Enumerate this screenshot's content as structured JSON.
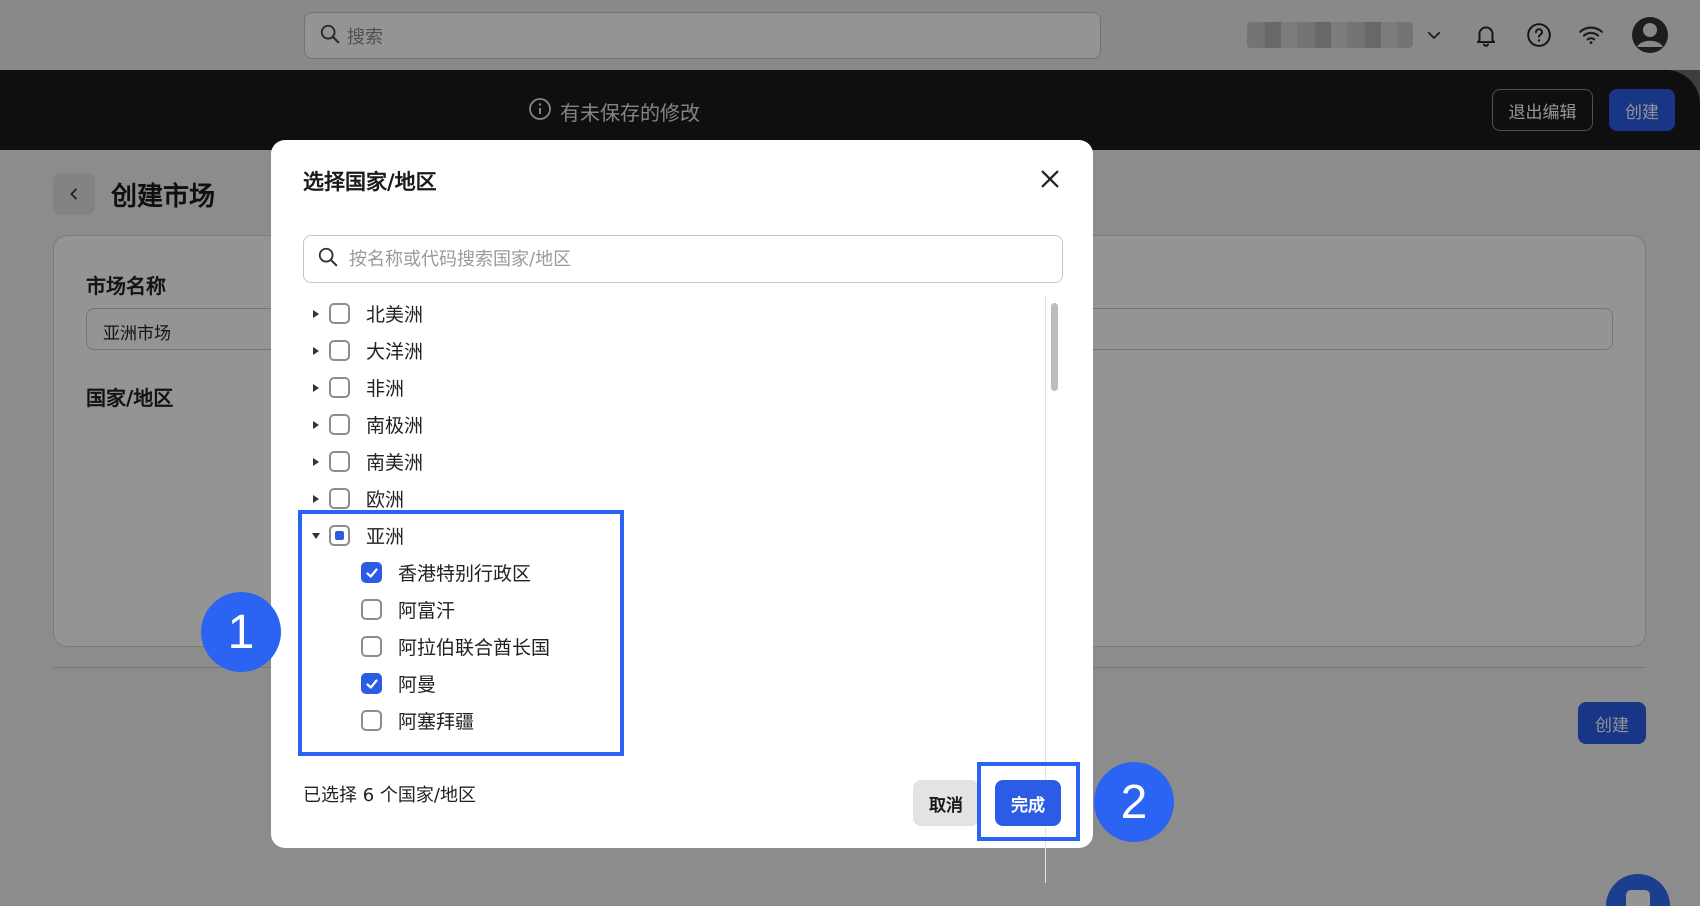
{
  "topbar": {
    "search_placeholder": "搜索",
    "icons": [
      "search-icon",
      "chevron-down-icon",
      "bell-icon",
      "help-icon",
      "wifi-icon",
      "avatar-icon"
    ]
  },
  "edit_bar": {
    "unsaved_text": "有未保存的修改",
    "exit_edit_label": "退出编辑",
    "create_label": "创建"
  },
  "page": {
    "title": "创建市场",
    "market_name_label": "市场名称",
    "market_name_value": "亚洲市场",
    "country_region_label": "国家/地区",
    "create_label": "创建"
  },
  "modal": {
    "title": "选择国家/地区",
    "search_placeholder": "按名称或代码搜索国家/地区",
    "tree": [
      {
        "label": "北美洲",
        "state": "unchecked",
        "expanded": false
      },
      {
        "label": "大洋洲",
        "state": "unchecked",
        "expanded": false
      },
      {
        "label": "非洲",
        "state": "unchecked",
        "expanded": false
      },
      {
        "label": "南极洲",
        "state": "unchecked",
        "expanded": false
      },
      {
        "label": "南美洲",
        "state": "unchecked",
        "expanded": false
      },
      {
        "label": "欧洲",
        "state": "unchecked",
        "expanded": false
      },
      {
        "label": "亚洲",
        "state": "partial",
        "expanded": true,
        "children": [
          {
            "label": "香港特别行政区",
            "state": "checked"
          },
          {
            "label": "阿富汗",
            "state": "unchecked"
          },
          {
            "label": "阿拉伯联合酋长国",
            "state": "unchecked"
          },
          {
            "label": "阿曼",
            "state": "checked"
          },
          {
            "label": "阿塞拜疆",
            "state": "unchecked"
          }
        ]
      }
    ],
    "selected_count_text": "已选择 6 个国家/地区",
    "cancel_label": "取消",
    "done_label": "完成"
  },
  "annotations": {
    "step_1": "1",
    "step_2": "2",
    "highlight_color": "#2b63f2"
  },
  "colors": {
    "accent": "#2c5ce6",
    "edit_bar": "#1a1a1a"
  }
}
